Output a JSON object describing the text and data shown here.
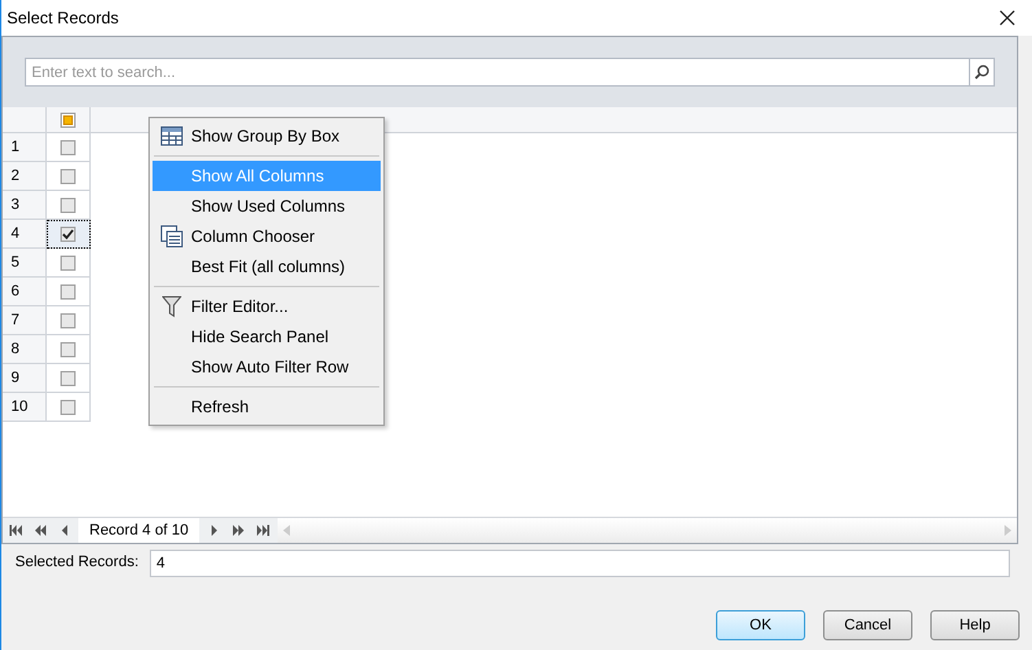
{
  "window": {
    "title": "Select Records"
  },
  "search": {
    "placeholder": "Enter text to search..."
  },
  "grid": {
    "header_checkbox": {
      "indeterminate": true
    },
    "rows": [
      {
        "number": "1",
        "checked": false,
        "focused": false
      },
      {
        "number": "2",
        "checked": false,
        "focused": false
      },
      {
        "number": "3",
        "checked": false,
        "focused": false
      },
      {
        "number": "4",
        "checked": true,
        "focused": true
      },
      {
        "number": "5",
        "checked": false,
        "focused": false
      },
      {
        "number": "6",
        "checked": false,
        "focused": false
      },
      {
        "number": "7",
        "checked": false,
        "focused": false
      },
      {
        "number": "8",
        "checked": false,
        "focused": false
      },
      {
        "number": "9",
        "checked": false,
        "focused": false
      },
      {
        "number": "10",
        "checked": false,
        "focused": false
      }
    ]
  },
  "context_menu": [
    {
      "kind": "group_by",
      "label": "Show Group By Box",
      "selected": false
    },
    {
      "kind": "separator"
    },
    {
      "kind": "plain",
      "label": "Show All Columns",
      "selected": true
    },
    {
      "kind": "plain",
      "label": "Show Used Columns",
      "selected": false
    },
    {
      "kind": "column_chooser",
      "label": "Column Chooser",
      "selected": false
    },
    {
      "kind": "plain",
      "label": "Best Fit (all columns)",
      "selected": false
    },
    {
      "kind": "separator"
    },
    {
      "kind": "filter",
      "label": "Filter Editor...",
      "selected": false
    },
    {
      "kind": "plain",
      "label": "Hide Search Panel",
      "selected": false
    },
    {
      "kind": "plain",
      "label": "Show Auto Filter Row",
      "selected": false
    },
    {
      "kind": "separator"
    },
    {
      "kind": "plain",
      "label": "Refresh",
      "selected": false
    }
  ],
  "navigator": {
    "record_text": "Record 4 of 10"
  },
  "selected_records": {
    "label": "Selected Records:",
    "value": "4"
  },
  "buttons": [
    {
      "label": "OK",
      "default": true
    },
    {
      "label": "Cancel",
      "default": false
    },
    {
      "label": "Help",
      "default": false
    }
  ]
}
